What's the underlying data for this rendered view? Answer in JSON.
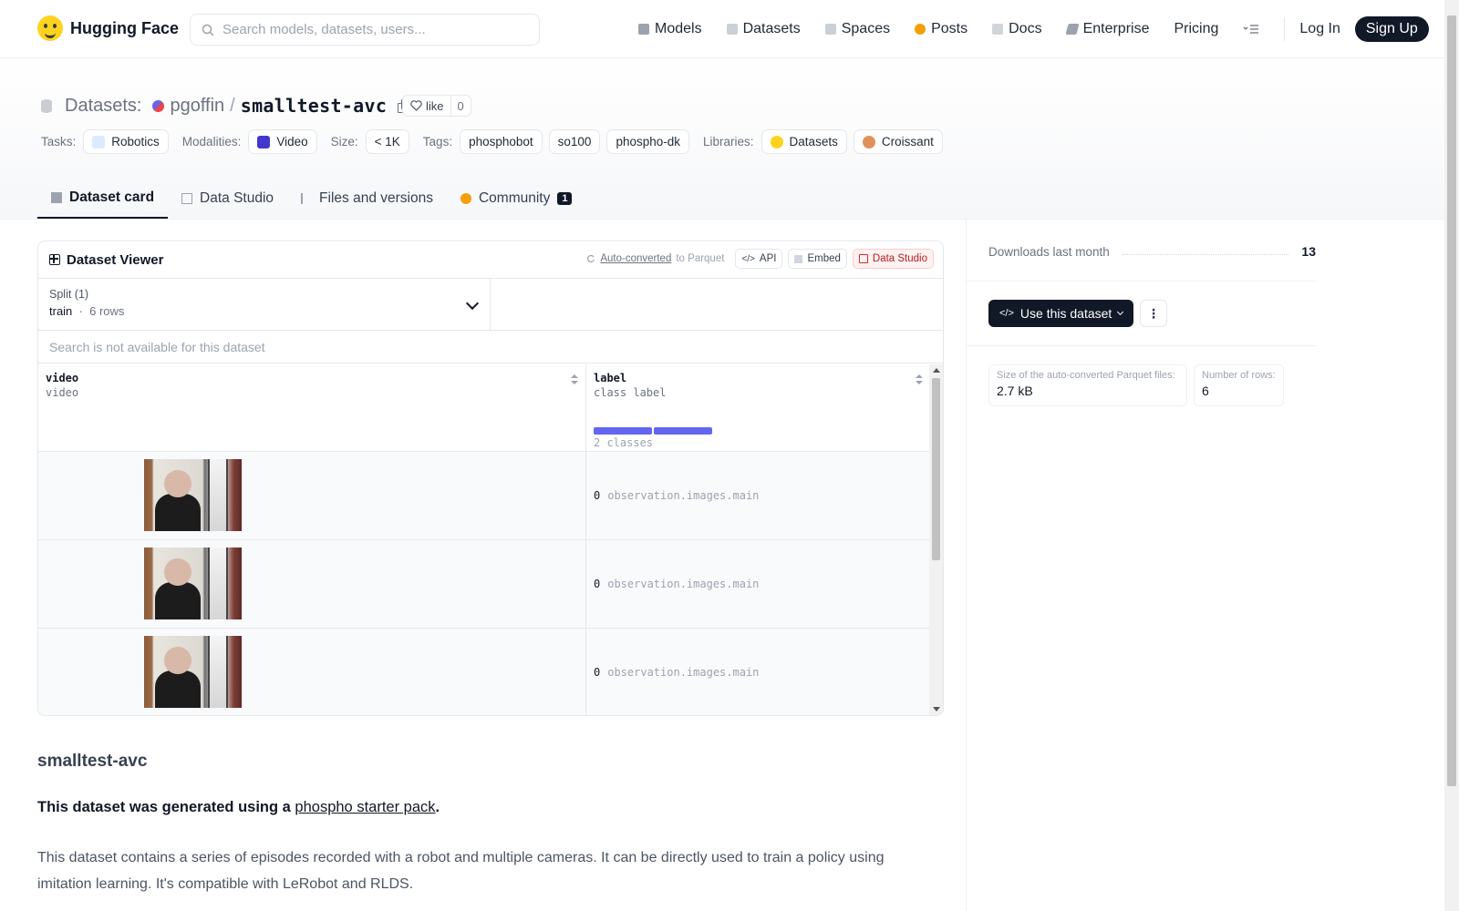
{
  "header": {
    "brand": "Hugging Face",
    "search_placeholder": "Search models, datasets, users...",
    "nav": [
      {
        "label": "Models",
        "icon": "cube-icon",
        "color": "#6b7280"
      },
      {
        "label": "Datasets",
        "icon": "database-icon",
        "color": "#9ca3af"
      },
      {
        "label": "Spaces",
        "icon": "grid-icon",
        "color": "#9ca3af"
      },
      {
        "label": "Posts",
        "icon": "speech-bubble-icon",
        "color": "#f59e0b"
      },
      {
        "label": "Docs",
        "icon": "book-icon",
        "color": "#9ca3af"
      },
      {
        "label": "Enterprise",
        "icon": "enterprise-icon",
        "color": "#6b7280"
      },
      {
        "label": "Pricing"
      }
    ],
    "login": "Log In",
    "signup": "Sign Up"
  },
  "dataset": {
    "section_label": "Datasets:",
    "owner": "pgoffin",
    "name": "smalltest-avc",
    "like_label": "like",
    "like_count": "0"
  },
  "meta": {
    "tasks_key": "Tasks:",
    "tasks": [
      "Robotics"
    ],
    "modalities_key": "Modalities:",
    "modalities": [
      "Video"
    ],
    "size_key": "Size:",
    "size": "< 1K",
    "tags_key": "Tags:",
    "tags": [
      "phosphobot",
      "so100",
      "phospho-dk"
    ],
    "libraries_key": "Libraries:",
    "libraries": [
      "Datasets",
      "Croissant"
    ]
  },
  "tabs": [
    {
      "label": "Dataset card",
      "active": true
    },
    {
      "label": "Data Studio"
    },
    {
      "label": "Files and versions"
    },
    {
      "label": "Community",
      "badge": "1"
    }
  ],
  "viewer": {
    "title": "Dataset Viewer",
    "autoconv_link": "Auto-converted",
    "autoconv_rest": "to Parquet",
    "api": "API",
    "embed": "Embed",
    "studio": "Data Studio",
    "split_label": "Split (1)",
    "split_name": "train",
    "split_dot": "·",
    "split_rows": "6 rows",
    "search_na": "Search is not available for this dataset",
    "columns": [
      {
        "name": "video",
        "type": "video"
      },
      {
        "name": "label",
        "type": "class label",
        "classes": "2 classes"
      }
    ],
    "rows": [
      {
        "label_value": "0",
        "label_name": "observation.images.main"
      },
      {
        "label_value": "0",
        "label_name": "observation.images.main"
      },
      {
        "label_value": "0",
        "label_name": "observation.images.main"
      }
    ]
  },
  "card": {
    "heading": "smalltest-avc",
    "intro_prefix": "This dataset was generated using a ",
    "intro_link": "phospho starter pack",
    "intro_suffix": ".",
    "body": "This dataset contains a series of episodes recorded with a robot and multiple cameras. It can be directly used to train a policy using imitation learning. It's compatible with LeRobot and RLDS."
  },
  "sidebar": {
    "downloads_label": "Downloads last month",
    "downloads": "13",
    "use_button": "Use this dataset",
    "stats": [
      {
        "key": "Size of the auto-converted Parquet files:",
        "value": "2.7 kB"
      },
      {
        "key": "Number of rows:",
        "value": "6"
      }
    ]
  }
}
